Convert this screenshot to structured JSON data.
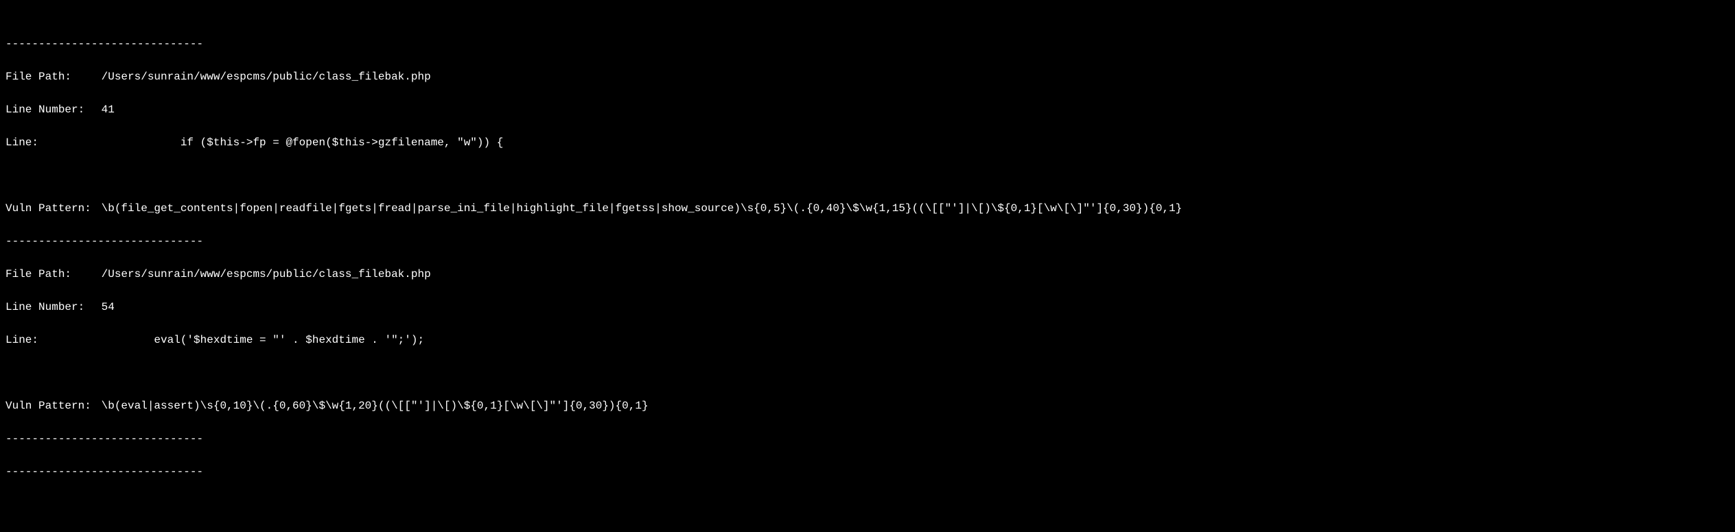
{
  "separator": "------------------------------",
  "entries": [
    {
      "filePath": "/Users/sunrain/www/espcms/public/class_filebak.php",
      "lineNumber": "41",
      "lineContent": "            if ($this->fp = @fopen($this->gzfilename, \"w\")) {",
      "vulnPattern": "\\b(file_get_contents|fopen|readfile|fgets|fread|parse_ini_file|highlight_file|fgetss|show_source)\\s{0,5}\\(.{0,40}\\$\\w{1,15}((\\[[\"']|\\[)\\${0,1}[\\w\\[\\]\"']{0,30}){0,1}"
    },
    {
      "filePath": "/Users/sunrain/www/espcms/public/class_filebak.php",
      "lineNumber": "54",
      "lineContent": "        eval('$hexdtime = \"' . $hexdtime . '\";');",
      "vulnPattern": "\\b(eval|assert)\\s{0,10}\\(.{0,60}\\$\\w{1,20}((\\[[\"']|\\[)\\${0,1}[\\w\\[\\]\"']{0,30}){0,1}"
    }
  ],
  "labels": {
    "filePath": "File Path:",
    "lineNumber": "Line Number:",
    "line": "Line:",
    "vulnPattern": "Vuln Pattern:"
  }
}
